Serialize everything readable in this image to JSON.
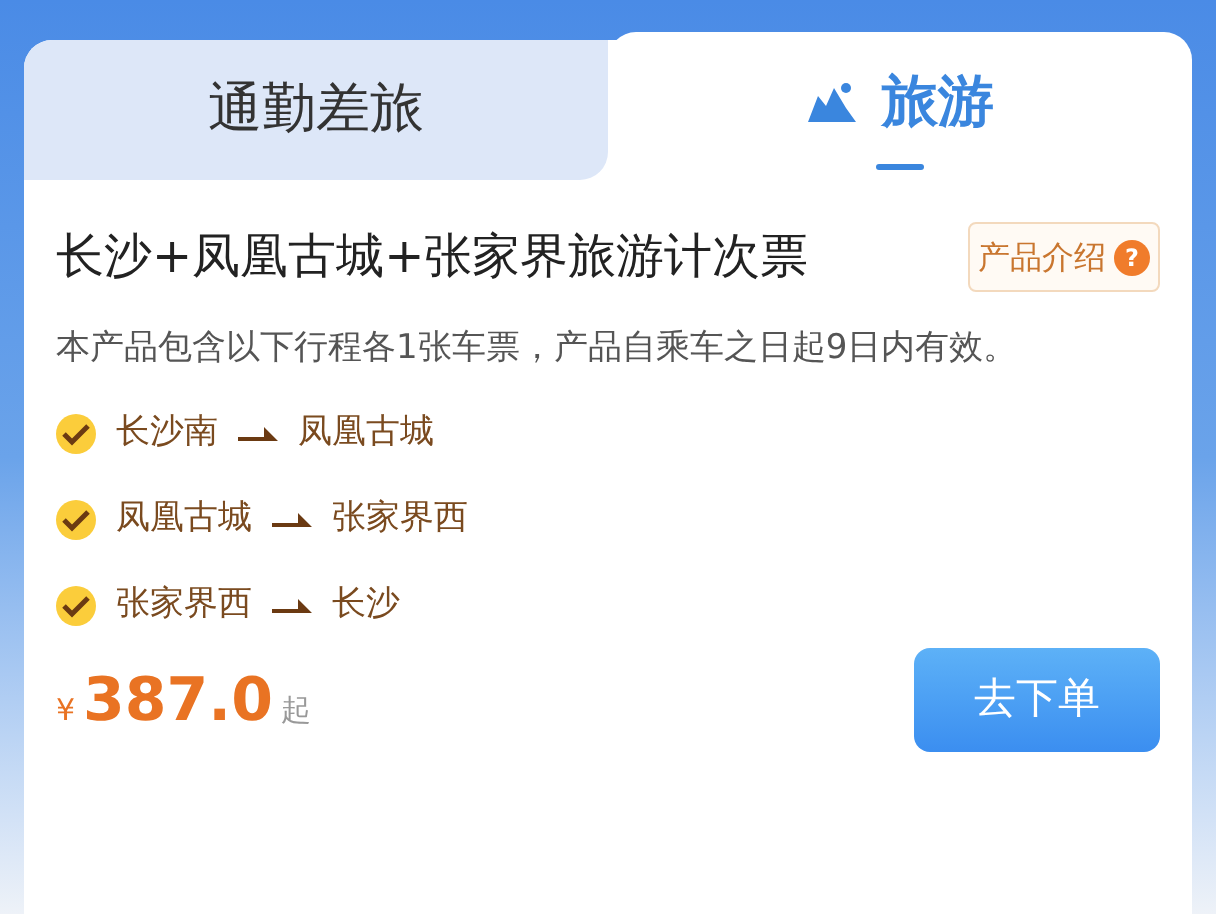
{
  "tabs": [
    {
      "label": "通勤差旅",
      "selected": false
    },
    {
      "label": "旅游",
      "selected": true
    }
  ],
  "product": {
    "title": "长沙+凤凰古城+张家界旅游计次票",
    "intro_button": "产品介绍",
    "intro_icon": "?",
    "description": "本产品包含以下行程各1张车票，产品自乘车之日起9日内有效。"
  },
  "routes": [
    {
      "from": "长沙南",
      "to": "凤凰古城"
    },
    {
      "from": "凤凰古城",
      "to": "张家界西"
    },
    {
      "from": "张家界西",
      "to": "长沙"
    }
  ],
  "price": {
    "currency": "¥",
    "amount": "387.0",
    "suffix": "起"
  },
  "order_button": "去下单"
}
